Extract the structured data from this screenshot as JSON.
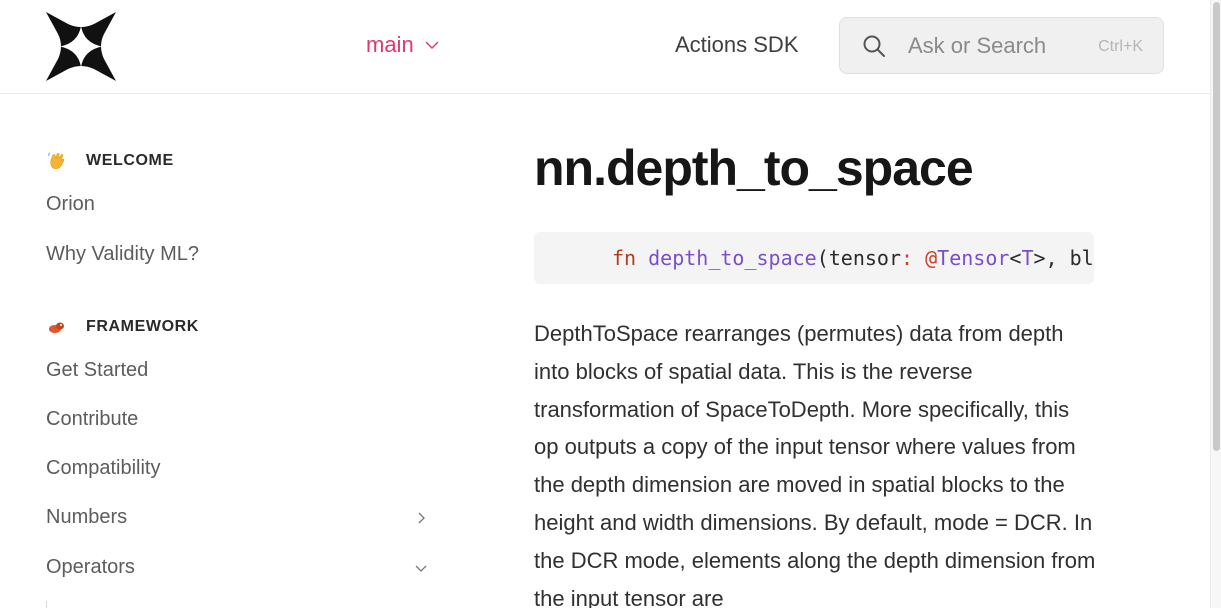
{
  "header": {
    "branch_label": "main",
    "sdk_link": "Actions SDK",
    "search": {
      "placeholder": "Ask or Search",
      "shortcut": "Ctrl+K"
    }
  },
  "sidebar": {
    "sections": [
      {
        "title": "WELCOME",
        "emoji": "waving-hand-icon",
        "items": [
          {
            "label": "Orion"
          },
          {
            "label": "Why Validity ML?"
          }
        ]
      },
      {
        "title": "FRAMEWORK",
        "emoji": "framework-blob-icon",
        "items": [
          {
            "label": "Get Started"
          },
          {
            "label": "Contribute"
          },
          {
            "label": "Compatibility"
          },
          {
            "label": "Numbers",
            "chevron": "chevron-right-icon"
          },
          {
            "label": "Operators",
            "chevron": "chevron-down-icon"
          }
        ]
      }
    ]
  },
  "main": {
    "title": "nn.depth_to_space",
    "code": {
      "keyword": "fn",
      "fn_name": "depth_to_space",
      "open_paren": "(",
      "param": "tensor",
      "colon": ":",
      "at": "@",
      "type_name": "Tensor",
      "lt": "<",
      "generic": "T",
      "rest": ">, bl"
    },
    "description": "DepthToSpace rearranges (permutes) data from depth into blocks of spatial data. This is the reverse transformation of SpaceToDepth. More specifically, this op outputs a copy of the input tensor where values from the depth dimension are moved in spatial blocks to the height and width dimensions. By default, mode = DCR. In the DCR mode, elements along the depth dimension from the input tensor are"
  },
  "colors": {
    "accent": "#e0386b",
    "keyword": "#b33a1f",
    "function": "#7a4fc9"
  }
}
